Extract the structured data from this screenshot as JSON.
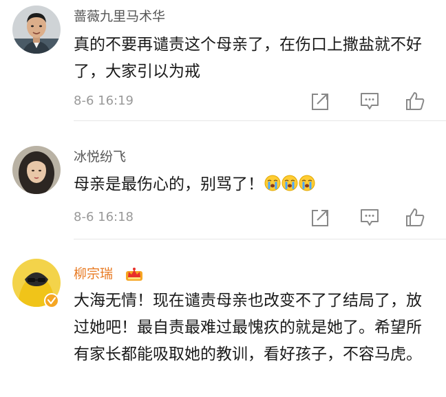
{
  "comments": [
    {
      "username": "蔷薇九里马术华",
      "text": "真的不要再谴责这个母亲了，在伤口上撒盐就不好了，大家引以为戒",
      "time": "8-6 16:19",
      "avatar_icon": "man-portrait-avatar"
    },
    {
      "username": "冰悦纷飞",
      "text": "母亲是最伤心的，别骂了！",
      "emoji": [
        "crying-face",
        "crying-face",
        "crying-face"
      ],
      "time": "8-6 16:18",
      "avatar_icon": "woman-portrait-avatar"
    },
    {
      "username": "柳宗瑞",
      "text": "大海无情！现在谴责母亲也改变不了了结局了，放过她吧！最自责最难过最愧疚的就是她了。希望所有家长都能吸取她的教训，看好孩子，不容马虎。",
      "avatar_icon": "yellow-hoodie-avatar",
      "badge": "vip-crown-icon",
      "verified": "verified-badge-icon"
    }
  ],
  "colors": {
    "username": "#555555",
    "vip_username": "#e87a22",
    "timestamp": "#999999",
    "icon": "#888888"
  }
}
